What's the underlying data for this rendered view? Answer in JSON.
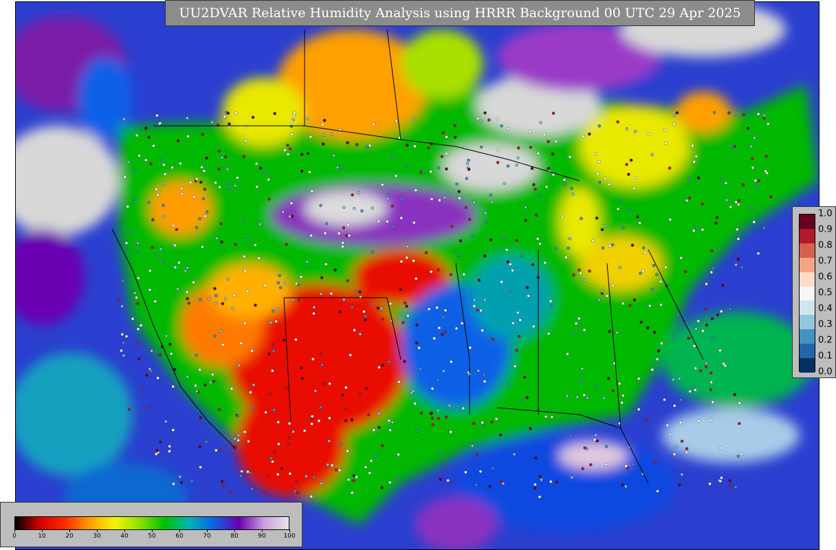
{
  "title": "UU2DVAR Relative Humidity Analysis using HRRR Background 00 UTC 29 Apr 2025",
  "humidity_scale": {
    "labels": [
      "0",
      "10",
      "20",
      "30",
      "40",
      "50",
      "60",
      "70",
      "80",
      "90",
      "100"
    ],
    "colors": [
      "#000000",
      "#d40000",
      "#ff2a00",
      "#ff9d00",
      "#f5f500",
      "#8de000",
      "#00c000",
      "#00b4b4",
      "#1060e6",
      "#6a00b0",
      "#c9a0dc",
      "#e6e6e6"
    ]
  },
  "observation_scale": {
    "labels": [
      "1.0",
      "0.9",
      "0.8",
      "0.7",
      "0.6",
      "0.5",
      "0.4",
      "0.3",
      "0.2",
      "0.1",
      "0.0"
    ],
    "colors": [
      "#67001f",
      "#b2182b",
      "#d6604d",
      "#f4a582",
      "#fddbc7",
      "#f7f7f7",
      "#d1e5f0",
      "#92c5de",
      "#4393c3",
      "#2166ac",
      "#053061"
    ]
  },
  "colors": {
    "ocean": "#2a3fcf",
    "panel": "#bdbdbd",
    "title_bg": "#8c8c8c"
  }
}
